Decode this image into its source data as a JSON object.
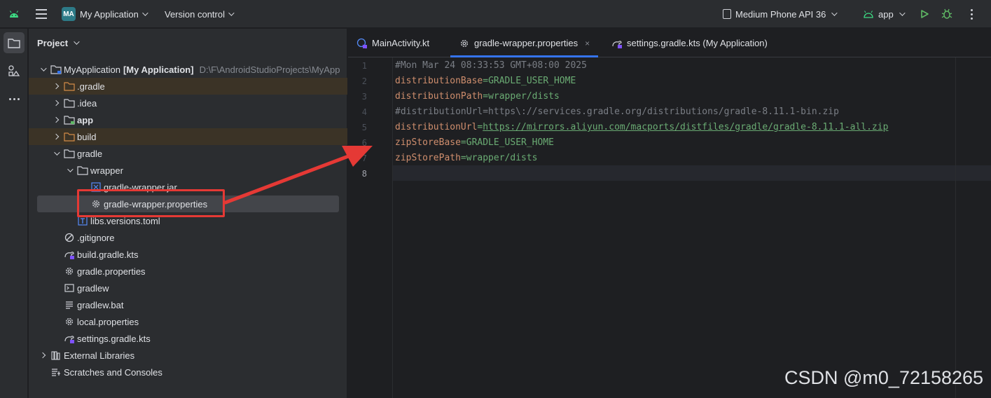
{
  "titlebar": {
    "project_badge": "MA",
    "project_name": "My Application",
    "vcs": "Version control",
    "device": "Medium Phone API 36",
    "run_config": "app"
  },
  "project_panel": {
    "title": "Project",
    "tree": [
      {
        "label": "MyApplication",
        "extra": "[My Application]",
        "path": "D:\\F\\AndroidStudioProjects\\MyApp"
      },
      {
        "label": ".gradle"
      },
      {
        "label": ".idea"
      },
      {
        "label": "app"
      },
      {
        "label": "build"
      },
      {
        "label": "gradle"
      },
      {
        "label": "wrapper"
      },
      {
        "label": "gradle-wrapper.jar"
      },
      {
        "label": "gradle-wrapper.properties"
      },
      {
        "label": "libs.versions.toml"
      },
      {
        "label": ".gitignore"
      },
      {
        "label": "build.gradle.kts"
      },
      {
        "label": "gradle.properties"
      },
      {
        "label": "gradlew"
      },
      {
        "label": "gradlew.bat"
      },
      {
        "label": "local.properties"
      },
      {
        "label": "settings.gradle.kts"
      },
      {
        "label": "External Libraries"
      },
      {
        "label": "Scratches and Consoles"
      }
    ]
  },
  "editor": {
    "tabs": [
      {
        "label": "MainActivity.kt"
      },
      {
        "label": "gradle-wrapper.properties",
        "close": "×"
      },
      {
        "label": "settings.gradle.kts (My Application)"
      }
    ],
    "line_numbers": [
      "1",
      "2",
      "3",
      "4",
      "5",
      "6",
      "7",
      "8"
    ],
    "lines": [
      {
        "comment": "#Mon Mar 24 08:33:53 GMT+08:00 2025"
      },
      {
        "key": "distributionBase",
        "eq": "=",
        "value": "GRADLE_USER_HOME"
      },
      {
        "key": "distributionPath",
        "eq": "=",
        "value": "wrapper/dists"
      },
      {
        "comment": "#distributionUrl=https\\://services.gradle.org/distributions/gradle-8.11.1-bin.zip"
      },
      {
        "key": "distributionUrl",
        "eq": "=",
        "value": "https://mirrors.aliyun.com/macports/distfiles/gradle/gradle-8.11.1-all.zip"
      },
      {
        "key": "zipStoreBase",
        "eq": "=",
        "value": "GRADLE_USER_HOME"
      },
      {
        "key": "zipStorePath",
        "eq": "=",
        "value": "wrapper/dists"
      }
    ]
  },
  "watermark": "CSDN @m0_72158265",
  "colors": {
    "accent": "#3574f0",
    "annotation_red": "#e53935",
    "key": "#cf8e6d",
    "value": "#6aab73",
    "comment": "#7a7e85"
  }
}
